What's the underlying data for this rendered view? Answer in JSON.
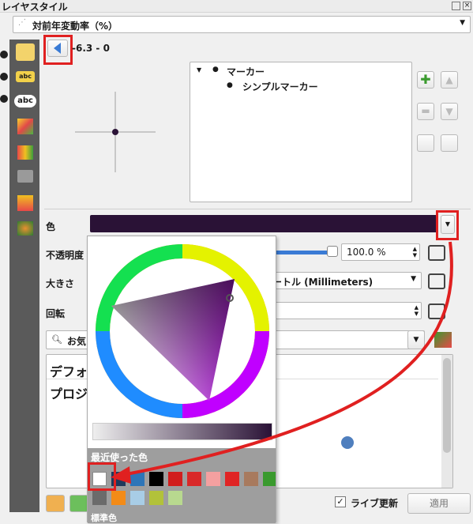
{
  "window": {
    "title": "レイヤスタイル"
  },
  "header": {
    "style_dropdown": "対前年変動率（%）",
    "range_label": "-6.3 - 0"
  },
  "tree": {
    "root": "マーカー",
    "child": "シンプルマーカー"
  },
  "props": {
    "color_label": "色",
    "color_value": "#2a1236",
    "opacity_label": "不透明度",
    "opacity_value": "100.0 %",
    "size_label": "大きさ",
    "size_unit": "ートル (Millimeters)",
    "rotation_label": "回転"
  },
  "library": {
    "search_placeholder": "お気",
    "items": [
      "デフォ",
      "プロジ"
    ]
  },
  "color_picker": {
    "recent_label": "最近使った色",
    "standard_label": "標準色",
    "recent_colors": [
      "#ffffff",
      "#1f3a5c",
      "#2d75b8",
      "#000000",
      "#d11d1d",
      "#d92828",
      "#f4a0a0",
      "#e02424",
      "#a87a5e",
      "#3a9a2e"
    ],
    "recent_colors_row2": [
      "#6b6b6b",
      "#f38b17",
      "#a8cde6",
      "#b2c23a",
      "#b8d98f"
    ]
  },
  "footer": {
    "live_update": "ライブ更新",
    "apply": "適用"
  },
  "preview": {
    "dot_color": "#4f7fbe"
  },
  "annotations": {
    "arrow_color": "#e02020"
  }
}
